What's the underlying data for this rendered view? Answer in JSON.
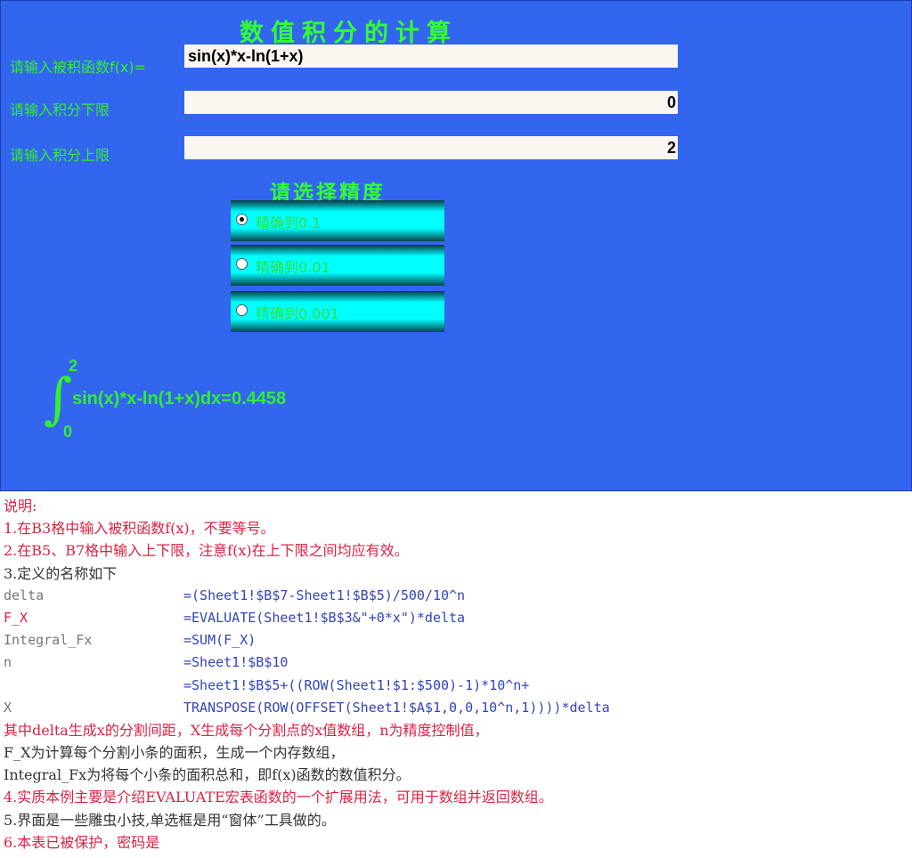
{
  "title": "数值积分的计算",
  "inputs": [
    {
      "label": "请输入被积函数f(x)=",
      "value": "sin(x)*x-ln(1+x)",
      "align": "left"
    },
    {
      "label": "请输入积分下限",
      "value": "0",
      "align": "right"
    },
    {
      "label": "请输入积分上限",
      "value": "2",
      "align": "right"
    }
  ],
  "precision": {
    "title": "请选择精度",
    "options": [
      {
        "label": "精确到0.1",
        "selected": true
      },
      {
        "label": "精确到0.01",
        "selected": false
      },
      {
        "label": "精确到0.001",
        "selected": false
      }
    ]
  },
  "result": {
    "integral_symbol": "∫",
    "upper": "2",
    "lower": "0",
    "expression": "sin(x)*x-ln(1+x)dx=0.4458"
  },
  "notes": {
    "heading": "说明:",
    "n1": "1.在B3格中输入被积函数f(x)，不要等号。",
    "n2a": "2.在B5、B7格中输入上下限，",
    "n2b": "注意f(x)在上下限之间均应有效。",
    "n3": "3.定义的名称如下",
    "defs": [
      {
        "name": "delta",
        "formula": "=(Sheet1!$B$7-Sheet1!$B$5)/500/10^n"
      },
      {
        "name": "F_X",
        "formula": "=EVALUATE(Sheet1!$B$3&\"+0*x\")*delta"
      },
      {
        "name": "Integral_Fx",
        "formula": "=SUM(F_X)"
      },
      {
        "name": "n",
        "formula": "=Sheet1!$B$10"
      },
      {
        "name": "",
        "formula": "=Sheet1!$B$5+((ROW(Sheet1!$1:$500)-1)*10^n+"
      },
      {
        "name": "X",
        "formula": "TRANSPOSE(ROW(OFFSET(Sheet1!$A$1,0,0,10^n,1))))*delta"
      }
    ],
    "explain1": "其中delta生成x的分割间距，X生成每个分割点的x值数组，n为精度控制值，",
    "explain2": "F_X为计算每个分割小条的面积，生成一个内存数组，",
    "explain3": "Integral_Fx为将每个小条的面积总和，即f(x)函数的数值积分。",
    "n4": "4.实质本例主要是介绍EVALUATE宏表函数的一个扩展用法，可用于数组并返回数组。",
    "n5": "5.界面是一些雕虫小技,单选框是用“窗体”工具做的。",
    "n6": "6.本表已被保护，密码是"
  }
}
